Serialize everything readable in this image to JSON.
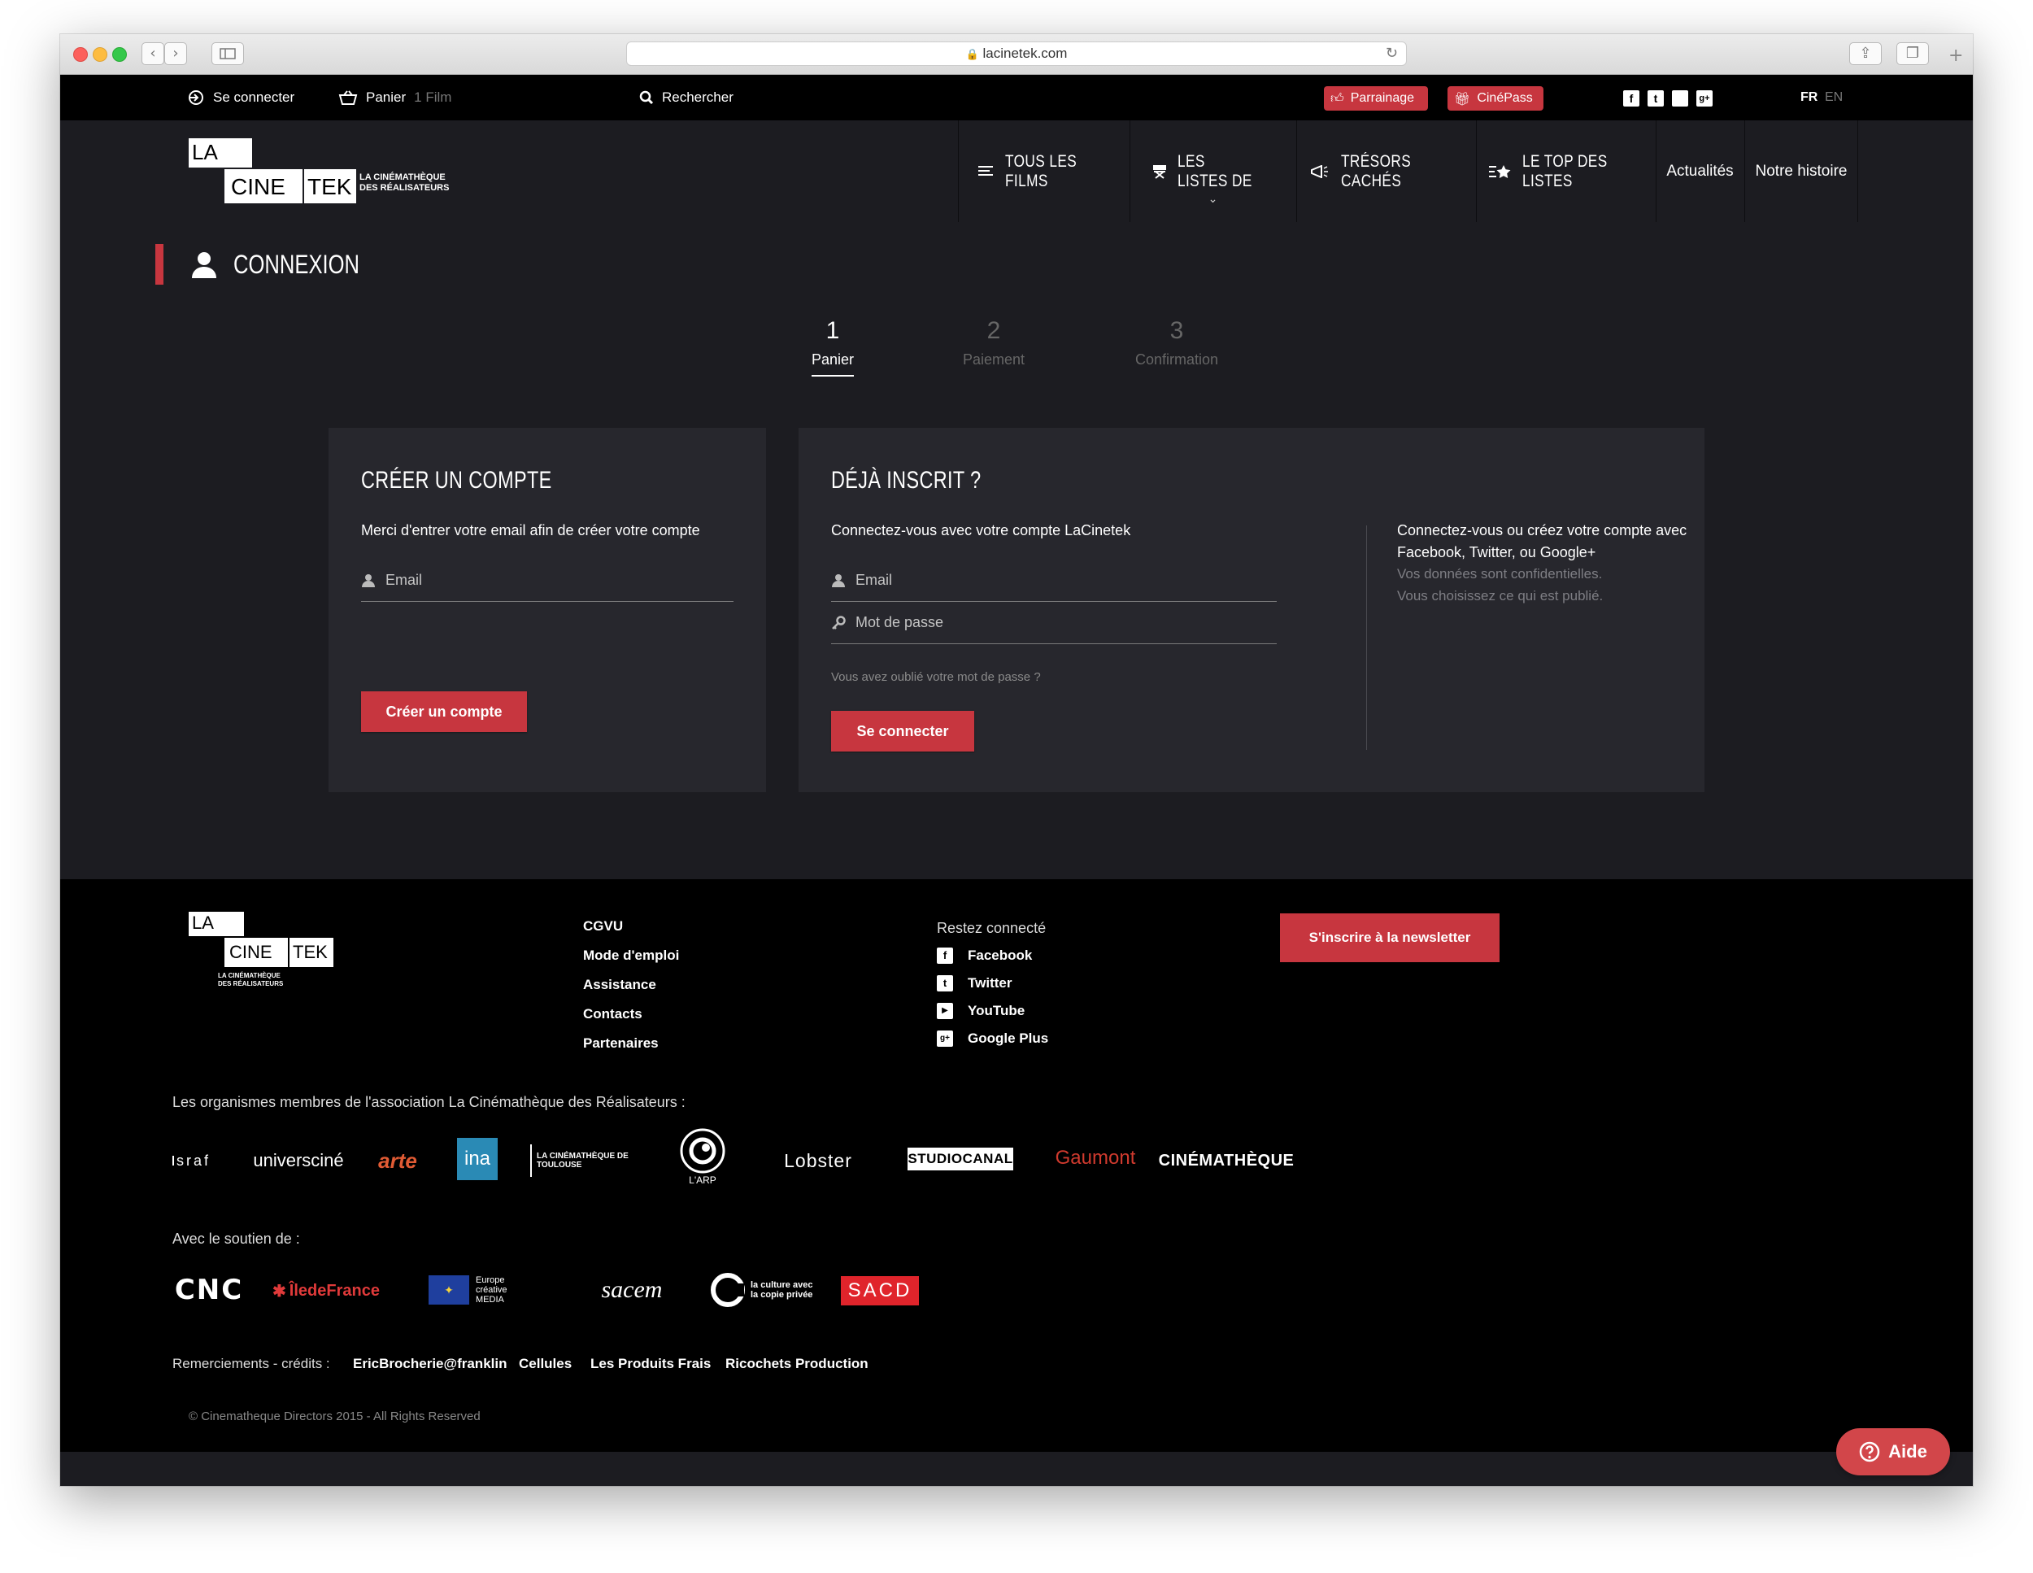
{
  "browser": {
    "url": "lacinetek.com",
    "back_icon": "chevron-left-icon",
    "forward_icon": "chevron-right-icon",
    "sidebar_icon": "sidebar-icon",
    "reload_icon": "reload-icon",
    "share_icon": "share-icon",
    "tabs_icon": "tabs-icon",
    "newtab_icon": "plus-icon"
  },
  "topbar": {
    "login": "Se connecter",
    "cart": "Panier",
    "cart_count": "1 Film",
    "search": "Rechercher",
    "parrainage": "Parrainage",
    "cinepass": "CinéPass",
    "social": [
      "f",
      "t",
      " ",
      "g+"
    ],
    "lang_active": "FR",
    "lang_other": "EN"
  },
  "logo": {
    "la": "LA",
    "cine": "CINE",
    "tek": "TEK",
    "tagline1": "LA CINÉMATHÈQUE",
    "tagline2": "DES RÉALISATEURS"
  },
  "nav": {
    "items": [
      {
        "label": "TOUS LES FILMS",
        "icon": "list-icon"
      },
      {
        "label": "LES LISTES DE",
        "icon": "directors-chair-icon"
      },
      {
        "label": "TRÉSORS CACHÉS",
        "icon": "megaphone-icon"
      },
      {
        "label": "LE TOP DES LISTES",
        "icon": "star-list-icon"
      },
      {
        "label": "Actualités",
        "icon": ""
      },
      {
        "label": "Notre histoire",
        "icon": ""
      }
    ]
  },
  "page": {
    "title": "CONNEXION"
  },
  "steps": [
    {
      "num": "1",
      "label": "Panier"
    },
    {
      "num": "2",
      "label": "Paiement"
    },
    {
      "num": "3",
      "label": "Confirmation"
    }
  ],
  "create": {
    "title": "CRÉER UN COMPTE",
    "intro": "Merci d'entrer votre email afin de créer votre compte",
    "email_placeholder": "Email",
    "button": "Créer un compte"
  },
  "login": {
    "title": "DÉJÀ INSCRIT ?",
    "intro": "Connectez-vous avec votre compte LaCinetek",
    "email_placeholder": "Email",
    "password_placeholder": "Mot de passe",
    "forgot": "Vous avez oublié votre mot de passe ?",
    "button": "Se connecter",
    "social_line1": "Connectez-vous ou créez votre compte avec",
    "social_line2": "Facebook, Twitter, ou Google+",
    "privacy_line1": "Vos données sont confidentielles.",
    "privacy_line2": "Vous choisissez ce qui est publié."
  },
  "footer": {
    "links": [
      "CGVU",
      "Mode d'emploi",
      "Assistance",
      "Contacts",
      "Partenaires"
    ],
    "connected_title": "Restez connecté",
    "connected": [
      {
        "label": "Facebook",
        "icon": "facebook-icon",
        "glyph": "f"
      },
      {
        "label": "Twitter",
        "icon": "twitter-icon",
        "glyph": "t"
      },
      {
        "label": "YouTube",
        "icon": "youtube-icon",
        "glyph": "▶"
      },
      {
        "label": "Google Plus",
        "icon": "google-plus-icon",
        "glyph": "g+"
      }
    ],
    "newsletter": "S'inscrire à la newsletter",
    "members_title": "Les organismes membres de l'association La Cinémathèque des Réalisateurs :",
    "members": [
      "sraf",
      "universciné",
      "arte",
      "ina",
      "LA CINÉMATHÈQUE DE TOULOUSE",
      "L'ARP",
      "Lobster",
      "STUDIOCANAL",
      "Gaumont",
      "CINÉMATHÈQUE"
    ],
    "support_title": "Avec le soutien de :",
    "supporters": [
      "CNC",
      "ÎledeFrance",
      "Europe créative MEDIA",
      "sacem",
      "la culture avec la copie privée",
      "SACD"
    ],
    "credits_label": "Remerciements - crédits :",
    "credits": [
      "EricBrocherie@franklin",
      "Cellules",
      "Les Produits Frais",
      "Ricochets Production"
    ],
    "copyright": "© Cinematheque Directors 2015 - All Rights Reserved"
  },
  "help": {
    "label": "Aide",
    "icon": "question-icon"
  },
  "colors": {
    "accent": "#c7363f",
    "background": "#1c1c21",
    "card": "#27272d",
    "footer": "#000000"
  }
}
